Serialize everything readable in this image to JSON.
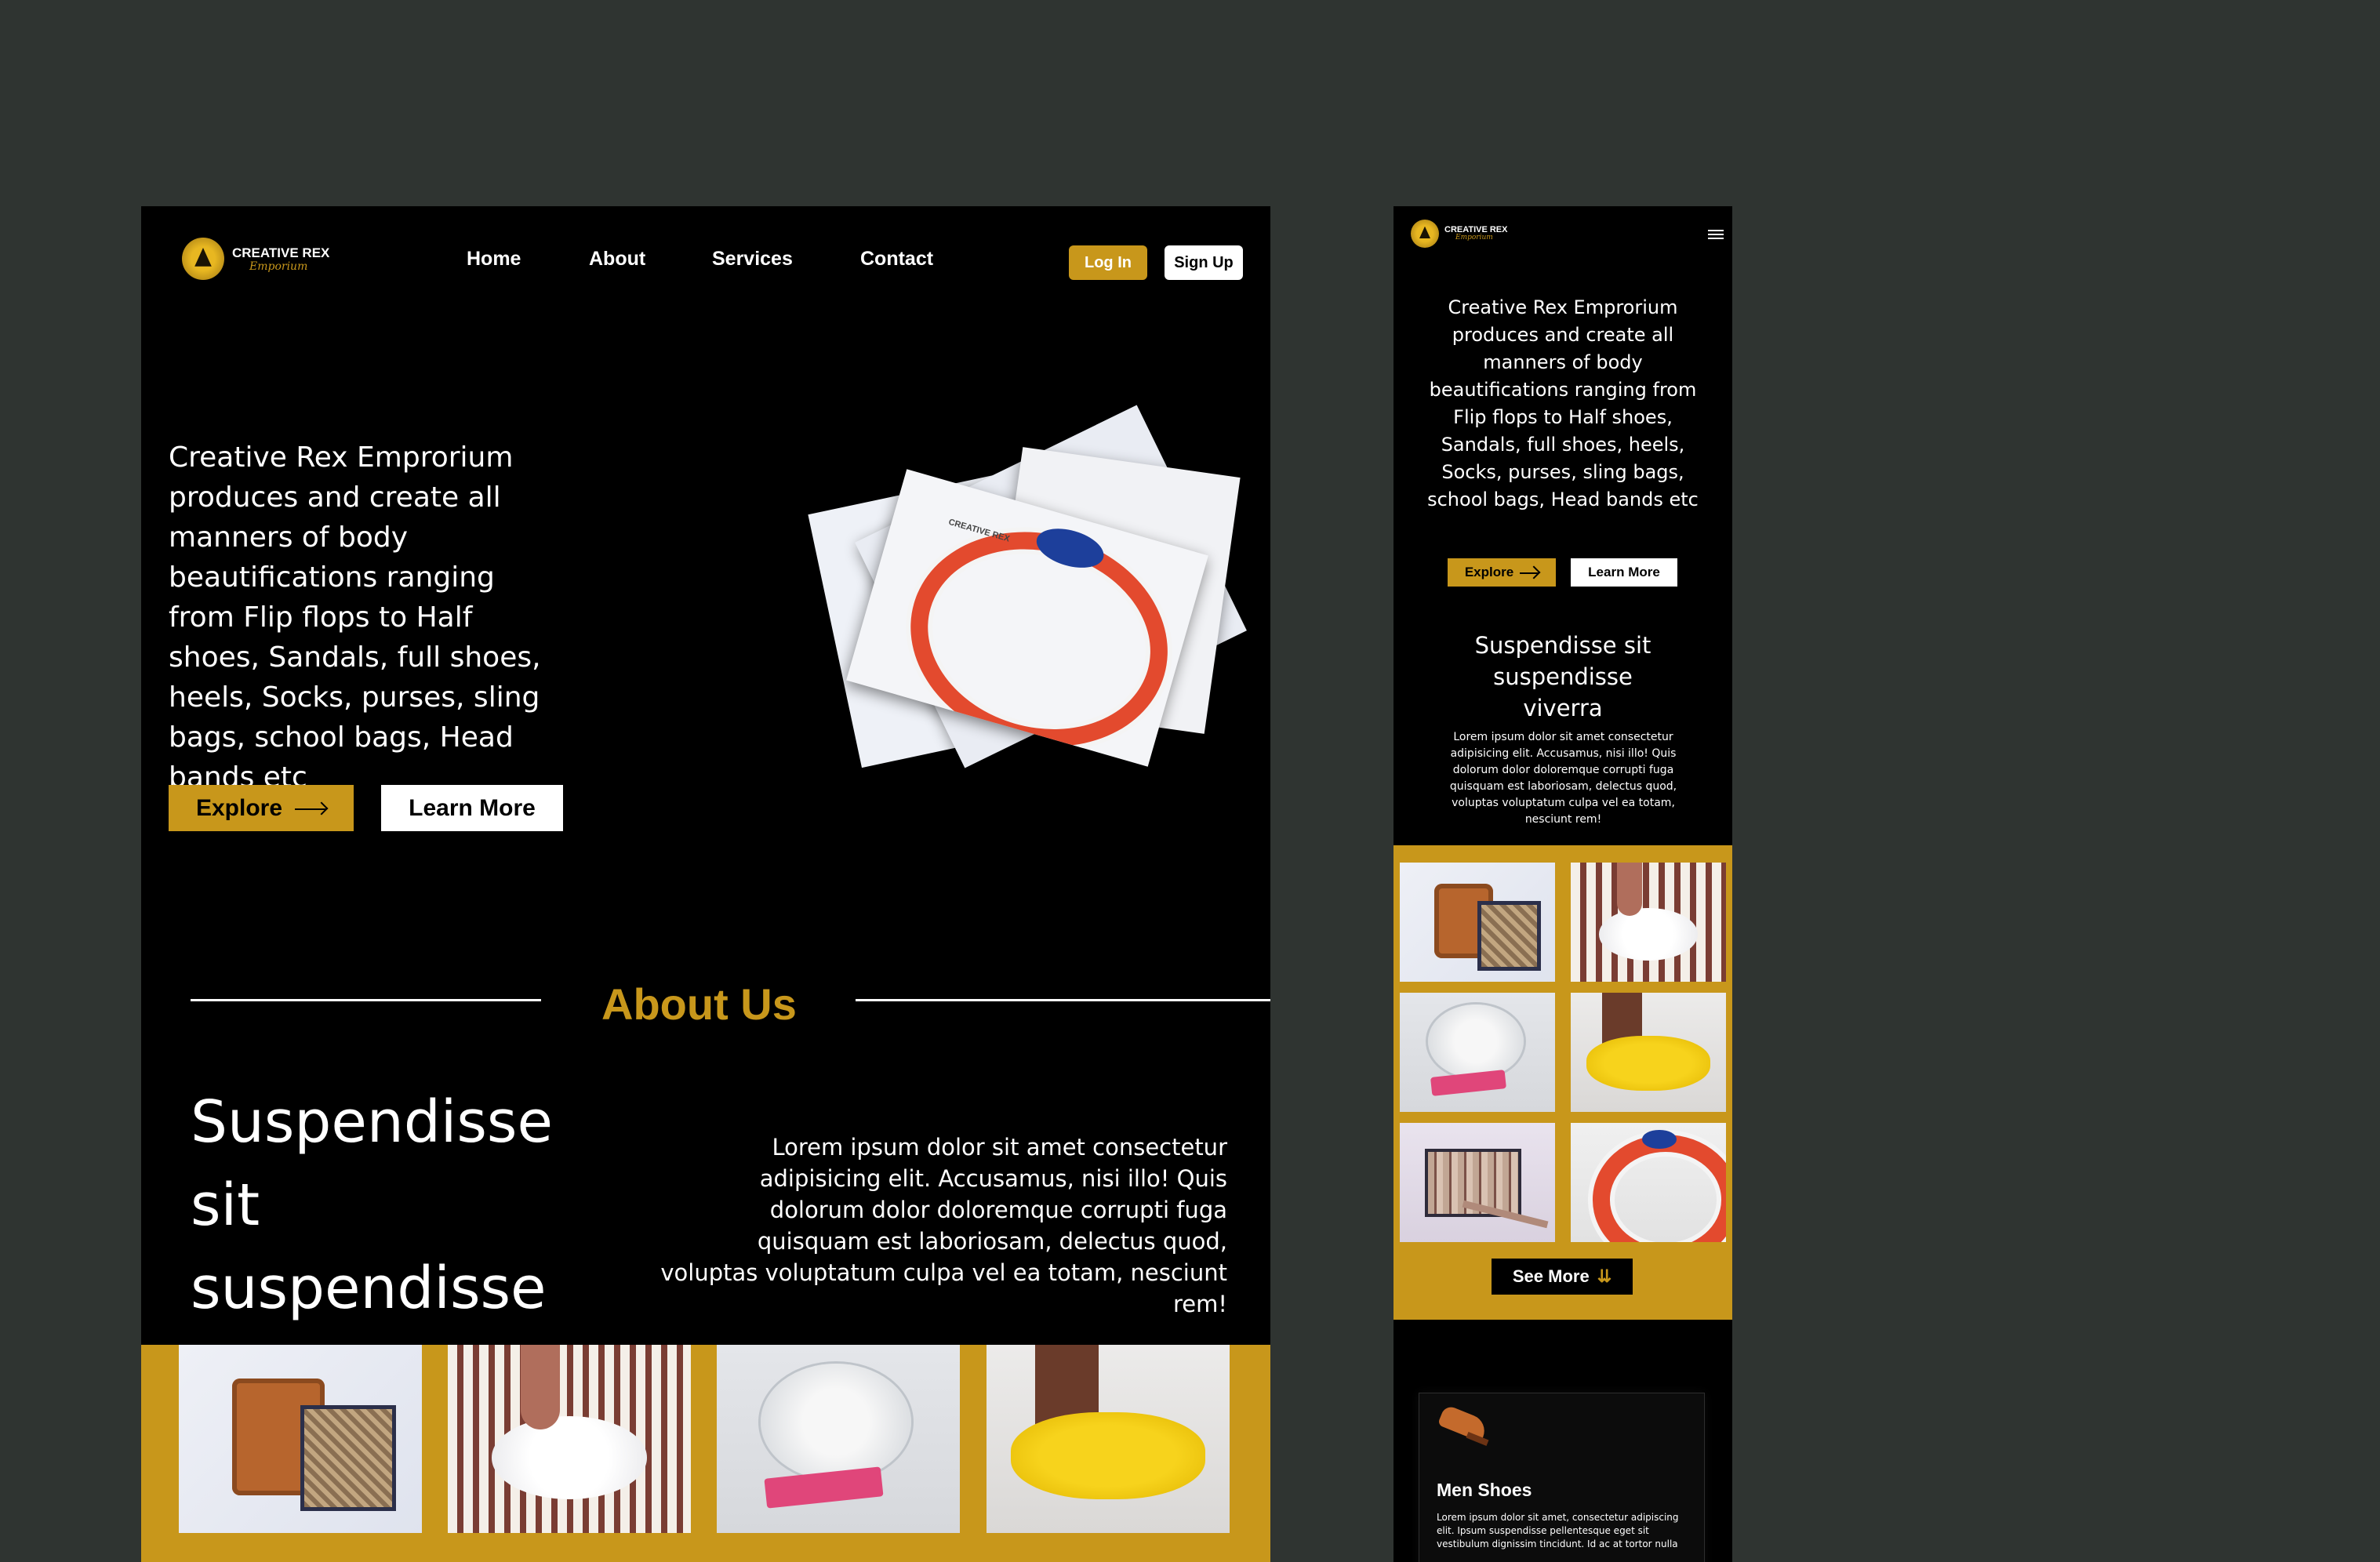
{
  "brand": {
    "name": "CREATIVE REX",
    "script": "Emporium"
  },
  "nav": {
    "links": [
      "Home",
      "About",
      "Services",
      "Contact"
    ],
    "login": "Log In",
    "signup": "Sign Up"
  },
  "hero": {
    "text": "Creative Rex Emprorium produces and create all manners of body beautifications ranging from Flip flops to Half shoes, Sandals, full shoes, heels, Socks, purses, sling bags, school bags, Head bands etc",
    "explore": "Explore",
    "learn_more": "Learn More",
    "image_badge": "CREATIVE REX"
  },
  "about": {
    "title": "About Us",
    "heading": "Suspendisse sit suspendisse viverra",
    "body": "Lorem ipsum dolor sit amet consectetur adipisicing elit. Accusamus, nisi illo! Quis dolorum dolor doloremque corrupti fuga quisquam est laboriosam, delectus quod, voluptas voluptatum culpa vel ea totam, nesciunt rem!"
  },
  "gallery": {
    "desktop": [
      "backpack",
      "slipper",
      "plate",
      "fur"
    ],
    "mobile": [
      "backpack",
      "slipper",
      "plate",
      "fur",
      "purse",
      "wreath"
    ],
    "see_more": "See More"
  },
  "mobile": {
    "hero_text": "Creative Rex Emprorium produces and create all manners of body beautifications ranging from Flip flops to Half shoes, Sandals, full shoes, heels, Socks, purses, sling bags, school bags, Head bands etc",
    "explore": "Explore",
    "learn_more": "Learn More",
    "about_heading": "Suspendisse sit suspendisse viverra",
    "about_body": "Lorem ipsum dolor sit amet consectetur adipisicing elit. Accusamus, nisi illo! Quis dolorum dolor doloremque corrupti fuga quisquam est laboriosam, delectus quod, voluptas voluptatum culpa vel ea totam, nesciunt rem!",
    "service_card": {
      "title": "Men Shoes",
      "body": "Lorem ipsum dolor sit amet, consectetur adipiscing elit. Ipsum suspendisse pellentesque eget sit vestibulum dignissim tincidunt. Id ac at tortor nulla"
    }
  },
  "colors": {
    "page_bg": "#2f3431",
    "frame_bg": "#000000",
    "accent": "#c8971b",
    "text": "#ffffff"
  },
  "icons": [
    "logo-crest-icon",
    "arrow-right-icon",
    "hamburger-icon",
    "chevron-double-down-icon",
    "shoe-icon"
  ]
}
